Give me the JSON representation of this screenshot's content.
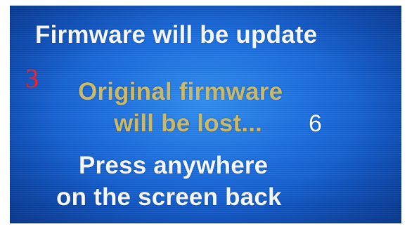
{
  "screen": {
    "title": "Firmware will be update",
    "warning_line1": "Original firmware",
    "warning_line2": "will be lost...",
    "instruction_line1": "Press anywhere",
    "instruction_line2": "on the screen back"
  },
  "annotations": {
    "marker_3": "3",
    "marker_6": "6"
  },
  "colors": {
    "background_blue": "#1a6ee0",
    "title_text": "#f4f6fa",
    "warning_text": "#c9b96a",
    "marker_3": "#ff1d1d",
    "marker_6": "#ffffff"
  }
}
